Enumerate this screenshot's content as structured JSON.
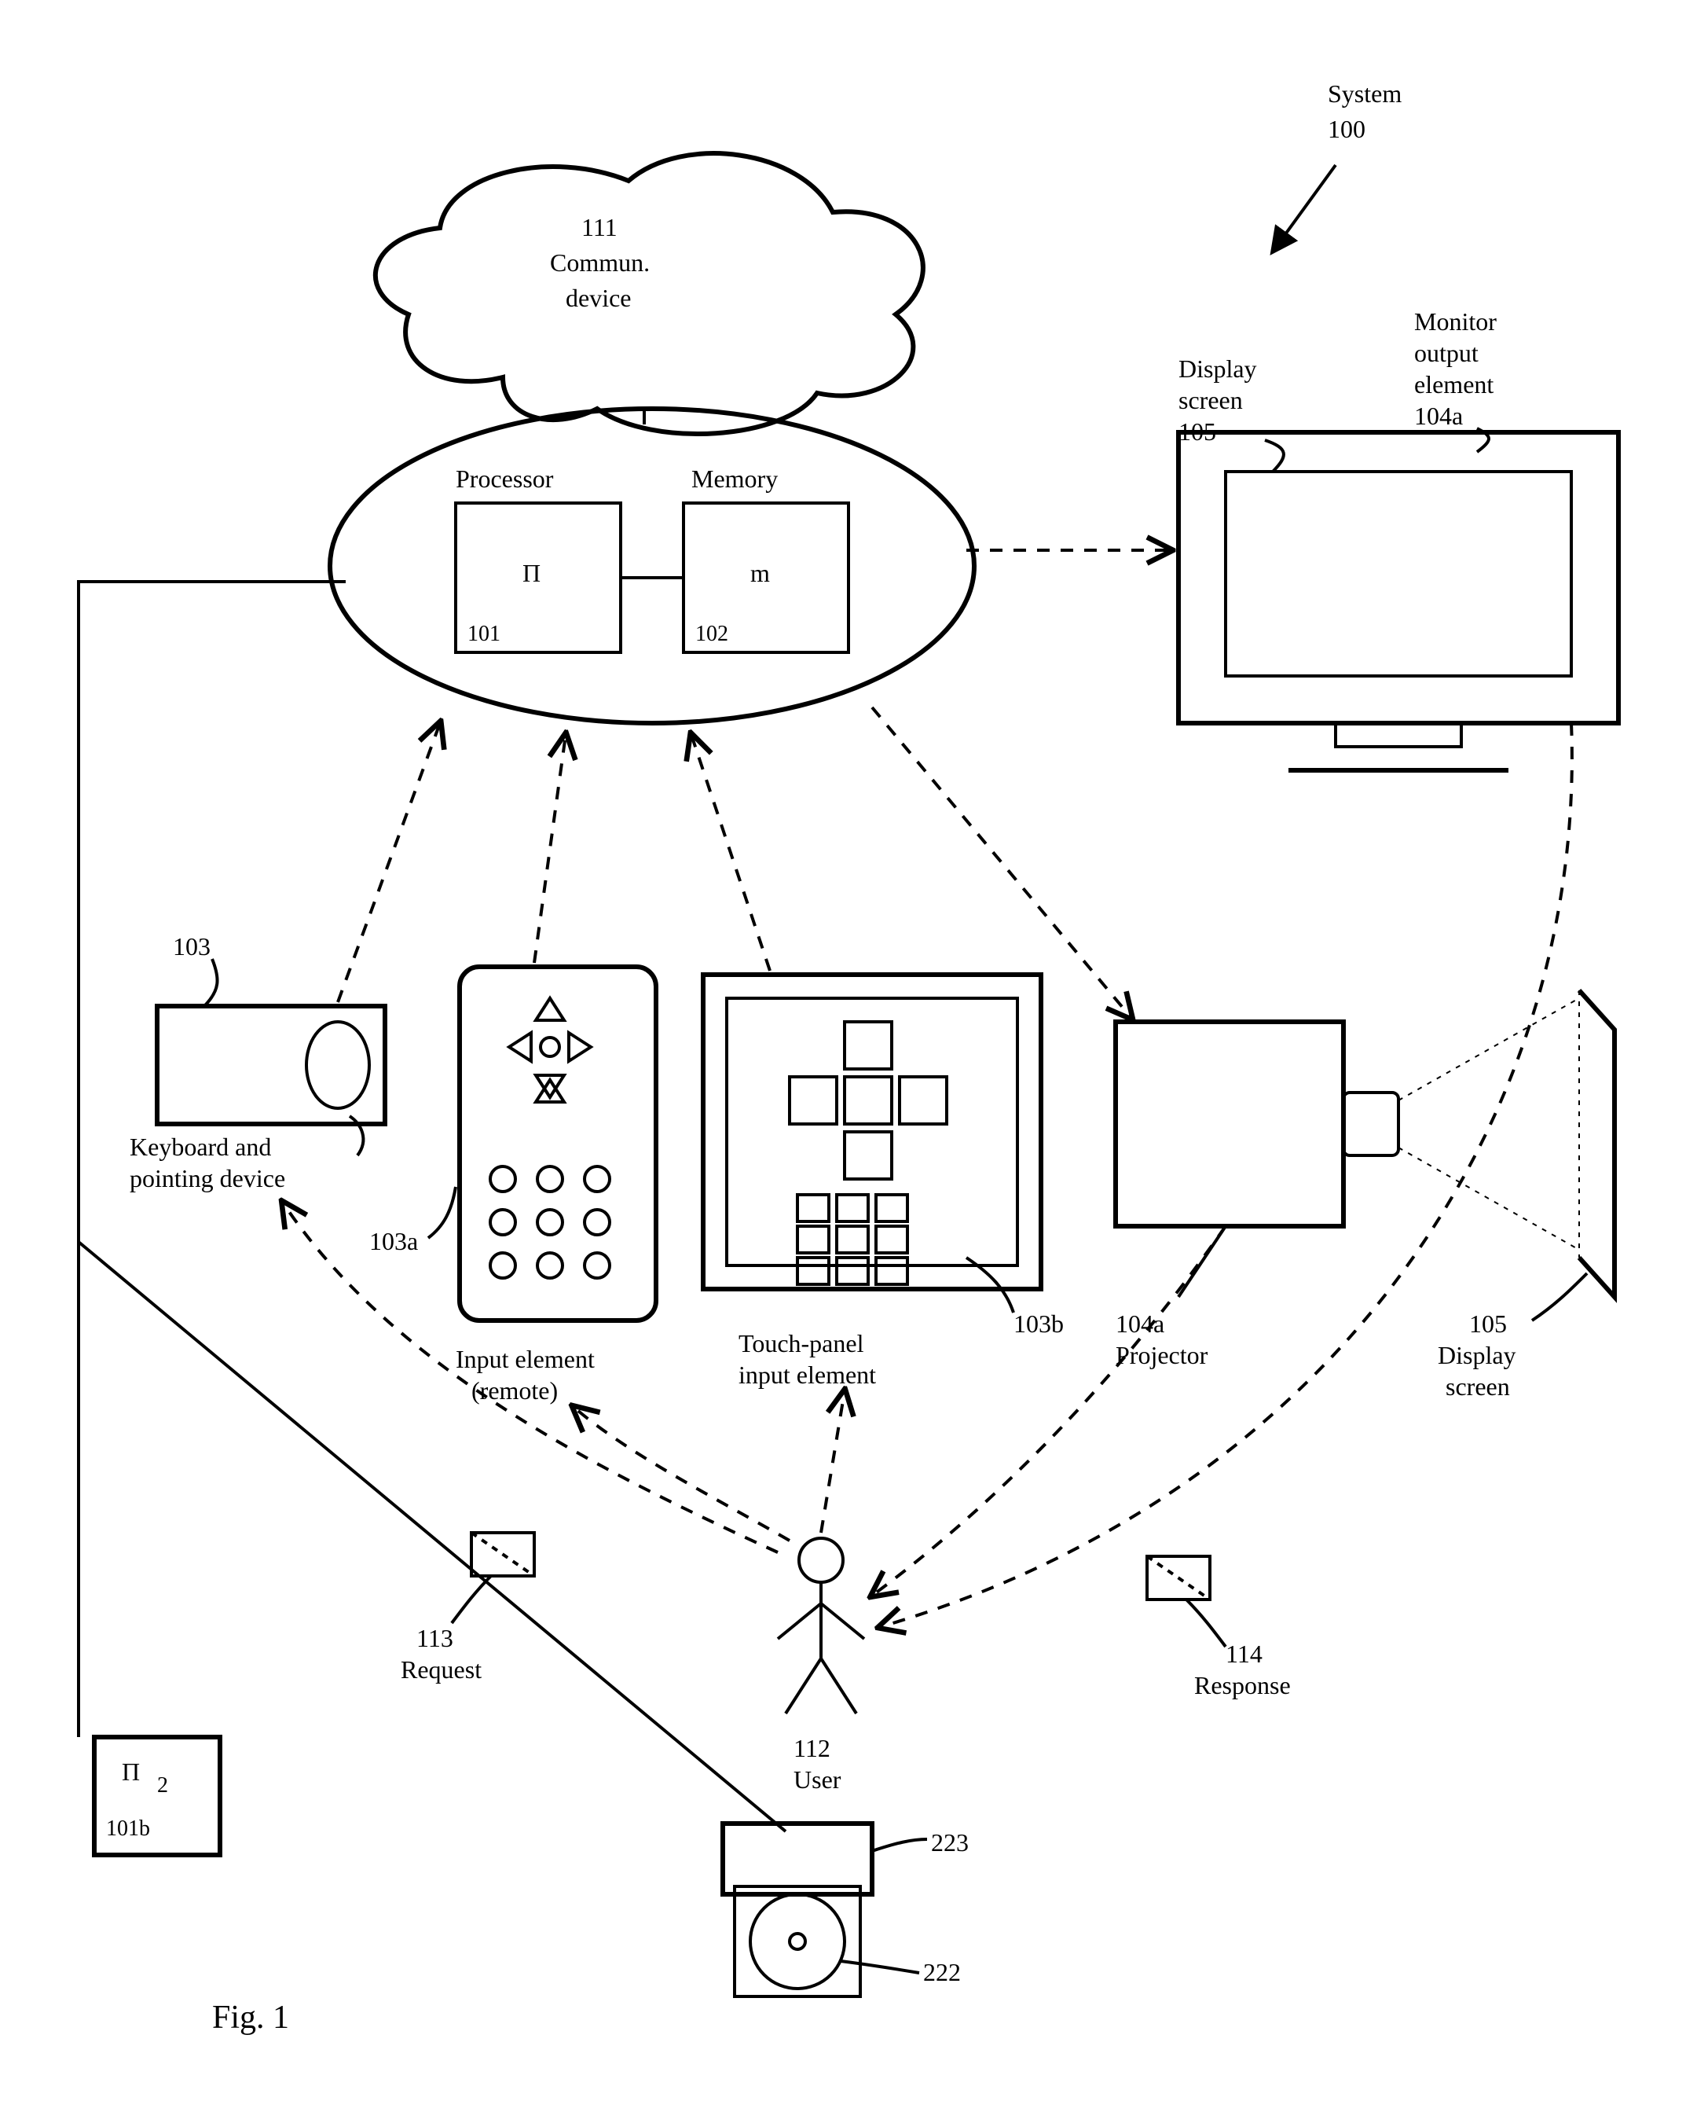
{
  "figure_label": "Fig. 1",
  "system": {
    "label": "System",
    "ref": "100"
  },
  "cloud": {
    "ref": "111",
    "line1": "Commun.",
    "line2": "device"
  },
  "processor": {
    "label": "Processor",
    "symbol": "Π",
    "ref": "101"
  },
  "memory": {
    "label": "Memory",
    "symbol": "m",
    "ref": "102"
  },
  "monitor": {
    "display_label": "Display",
    "screen_label": "screen",
    "display_ref": "105",
    "out1": "Monitor",
    "out2": "output",
    "out3": "element",
    "out_ref": "104a"
  },
  "keyboard": {
    "ref": "103",
    "line1": "Keyboard and",
    "line2": "pointing device"
  },
  "remote": {
    "ref": "103a",
    "line1": "Input element",
    "line2": "(remote)"
  },
  "touchpanel": {
    "ref": "103b",
    "line1": "Touch-panel",
    "line2": "input element"
  },
  "projector": {
    "ref": "104a",
    "label": "Projector"
  },
  "proj_screen": {
    "ref": "105",
    "line1": "Display",
    "line2": "screen"
  },
  "user": {
    "ref": "112",
    "label": "User"
  },
  "request": {
    "ref": "113",
    "label": "Request"
  },
  "response": {
    "ref": "114",
    "label": "Response"
  },
  "proc2": {
    "symbol": "Π",
    "sub": "2",
    "ref": "101b"
  },
  "drive": {
    "ref_outer": "223",
    "ref_inner": "222"
  }
}
